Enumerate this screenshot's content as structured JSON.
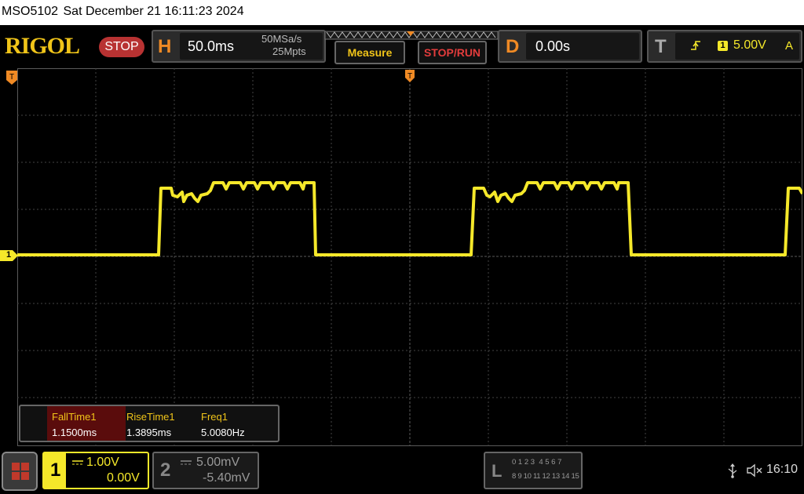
{
  "titlebar": {
    "model": "MSO5102",
    "datetime": "Sat December 21 16:11:23 2024"
  },
  "brand": {
    "logo": "RIGOL",
    "run_state": "STOP"
  },
  "horizontal": {
    "letter": "H",
    "timebase": "50.0ms",
    "sample_rate": "50MSa/s",
    "memory_depth": "25Mpts"
  },
  "buttons": {
    "measure": "Measure",
    "stop_run": "STOP/RUN"
  },
  "delay": {
    "letter": "D",
    "value": "0.00s"
  },
  "trigger": {
    "letter": "T",
    "channel": "1",
    "level": "5.00V",
    "mode": "A"
  },
  "markers": {
    "channel1": "1"
  },
  "measurements": {
    "headers": [
      "FallTime1",
      "RiseTime1",
      "Freq1"
    ],
    "values": [
      "1.1500ms",
      "1.3895ms",
      "5.0080Hz"
    ]
  },
  "channels": [
    {
      "number": "1",
      "scale": "1.00V",
      "offset": "0.00V",
      "coupling": "DC"
    },
    {
      "number": "2",
      "scale": "5.00mV",
      "offset": "-5.40mV",
      "coupling": "DC"
    }
  ],
  "logic": {
    "letter": "L",
    "row1": "0 1 2 3  4 5 6 7",
    "row2": "8 9 10 11 12 13 14 15"
  },
  "status": {
    "time": "16:10"
  },
  "colors": {
    "ch1": "#f5e82a",
    "orange": "#f08a24",
    "grid": "#444444"
  }
}
